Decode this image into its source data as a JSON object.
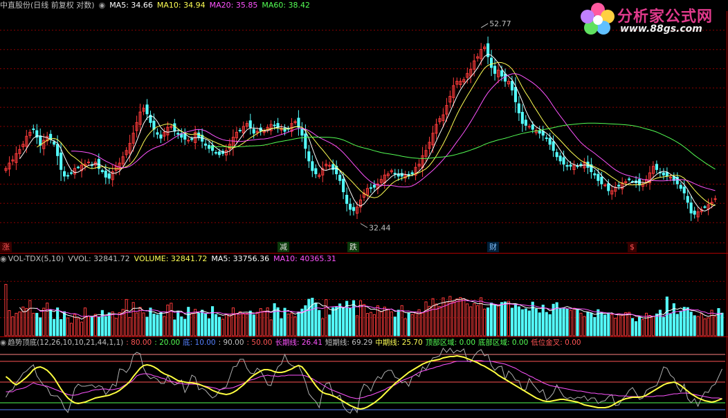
{
  "header": {
    "price": {
      "title": "中直股份(日线 前复权 对数)",
      "ma5": "MA5: 34.66",
      "ma10": "MA10: 34.94",
      "ma20": "MA20: 35.85",
      "ma60": "MA60: 38.42"
    },
    "vol": {
      "title": "VOL-TDX(5,10)",
      "vvol": "VVOL: 32841.72",
      "volume": "VOLUME: 32841.72",
      "ma5": "MA5: 33756.36",
      "ma10": "MA10: 40365.31"
    },
    "ind": {
      "title": "趋势顶底(12,26,10,10,21,44,1,1)",
      "v80": ": 80.00",
      "v20": ": 20.00",
      "di": "底: 10.00",
      "v90": ": 90.00",
      "v50": ": 50.00",
      "chang": "长期线: 26.41",
      "duan": "短期线: 69.29",
      "zhong": "中期线: 25.70",
      "dingqu": "顶部区域: 0.00",
      "diqu": "底部区域: 0.00",
      "jincha": "低位金叉: 0.00"
    }
  },
  "logo": {
    "text": "分析家公式网",
    "url": "www.88gs.com"
  },
  "events": {
    "zhang": "涨",
    "jian": "减",
    "die": "跌",
    "cai": "财",
    "dollar": "$"
  },
  "colors": {
    "up": "#ff3b3b",
    "down": "#54ffff",
    "ma5": "#ffffff",
    "ma10": "#ffff54",
    "ma20": "#ff54ff",
    "ma60": "#54ff54",
    "grid": "#8c0000",
    "text": "#c0c0c0"
  },
  "chart_data": [
    {
      "type": "candlestick",
      "name": "price",
      "title": "中直股份(日线 前复权 对数)",
      "log_scale": true,
      "ylim": [
        31,
        55
      ],
      "annotations": [
        {
          "label": "52.77",
          "day": 138,
          "price": 52.77
        },
        {
          "label": "32.44",
          "day": 103,
          "price": 32.44
        }
      ],
      "close": [
        37.2,
        37.7,
        38.0,
        38.6,
        39.0,
        39.5,
        40.3,
        40.7,
        41.0,
        40.2,
        39.4,
        39.9,
        40.3,
        40.0,
        39.5,
        38.4,
        37.1,
        36.5,
        36.5,
        36.8,
        37.2,
        37.3,
        37.5,
        37.6,
        37.8,
        37.5,
        37.8,
        37.2,
        36.9,
        36.4,
        36.3,
        36.9,
        37.4,
        37.7,
        38.3,
        38.9,
        39.6,
        40.6,
        41.7,
        42.8,
        43.2,
        42.6,
        41.7,
        41.0,
        40.5,
        40.1,
        40.7,
        41.2,
        41.3,
        40.8,
        40.5,
        40.2,
        40.0,
        39.9,
        40.0,
        40.7,
        40.2,
        39.8,
        39.4,
        39.1,
        38.9,
        38.7,
        38.5,
        38.6,
        38.9,
        39.5,
        40.2,
        40.7,
        40.9,
        41.3,
        41.6,
        41.2,
        40.6,
        40.8,
        40.8,
        40.8,
        41.2,
        41.5,
        41.4,
        41.2,
        41.1,
        40.8,
        41.0,
        41.6,
        41.8,
        41.2,
        40.4,
        39.1,
        37.9,
        37.0,
        36.7,
        36.6,
        37.2,
        37.6,
        37.5,
        37.1,
        36.7,
        36.1,
        35.1,
        34.1,
        33.6,
        33.5,
        33.8,
        34.4,
        35.0,
        35.4,
        35.4,
        35.5,
        35.8,
        36.2,
        36.6,
        36.7,
        37.0,
        36.7,
        36.5,
        36.5,
        36.6,
        36.5,
        36.7,
        37.3,
        37.6,
        38.4,
        38.9,
        39.7,
        40.6,
        41.5,
        42.1,
        42.5,
        43.5,
        44.5,
        45.7,
        46.2,
        46.2,
        46.4,
        47.1,
        47.6,
        48.6,
        49.1,
        50.0,
        50.3,
        49.1,
        47.8,
        47.1,
        47.5,
        46.8,
        46.2,
        46.2,
        45.2,
        43.9,
        42.7,
        41.6,
        41.4,
        41.3,
        41.0,
        40.9,
        40.6,
        40.4,
        40.1,
        39.5,
        38.9,
        38.3,
        37.9,
        37.6,
        37.4,
        37.4,
        37.5,
        37.4,
        37.5,
        37.8,
        37.3,
        36.9,
        36.6,
        36.1,
        35.8,
        35.7,
        35.2,
        35.2,
        35.5,
        35.6,
        35.9,
        36.0,
        36.2,
        36.0,
        35.9,
        35.7,
        35.8,
        36.2,
        36.8,
        37.4,
        37.1,
        36.8,
        36.6,
        36.5,
        36.4,
        36.1,
        35.8,
        35.4,
        35.0,
        34.2,
        33.3,
        33.2,
        33.4,
        33.6,
        33.8,
        34.0,
        34.2,
        34.5
      ],
      "ma_current": {
        "MA5": 34.66,
        "MA10": 34.94,
        "MA20": 35.85,
        "MA60": 38.42
      }
    },
    {
      "type": "bar",
      "name": "volume",
      "title": "VOL-TDX(5,10)",
      "ylim": [
        0,
        80000
      ],
      "values": [
        56700,
        27800,
        21000,
        24800,
        26400,
        31800,
        30200,
        38900,
        24800,
        24800,
        19900,
        30500,
        36100,
        28500,
        18100,
        30800,
        17900,
        26600,
        19700,
        13900,
        23500,
        19000,
        15200,
        30700,
        21400,
        21200,
        23600,
        20500,
        28000,
        21200,
        25300,
        26400,
        19300,
        25600,
        29100,
        40100,
        20300,
        36700,
        25200,
        31400,
        25200,
        20600,
        30600,
        24000,
        23100,
        25500,
        21400,
        34000,
        36000,
        17500,
        27300,
        20900,
        18300,
        31500,
        24700,
        29200,
        24800,
        28300,
        24500,
        18800,
        32200,
        23500,
        20400,
        18300,
        23400,
        23600,
        30800,
        24700,
        26500,
        24000,
        24700,
        27300,
        23100,
        25900,
        30000,
        27200,
        30800,
        17600,
        35500,
        30900,
        18900,
        30400,
        24000,
        25000,
        21000,
        26400,
        29500,
        33200,
        40300,
        41500,
        36300,
        28000,
        18900,
        39900,
        23000,
        31000,
        31700,
        35200,
        30900,
        38100,
        30200,
        38800,
        22200,
        38700,
        34600,
        24700,
        25800,
        23400,
        33100,
        26500,
        31700,
        29500,
        26500,
        20700,
        28300,
        33300,
        18800,
        25500,
        23500,
        25000,
        28800,
        25100,
        37400,
        32500,
        41000,
        35100,
        32300,
        41800,
        37300,
        43400,
        37400,
        40600,
        42300,
        40900,
        35200,
        32000,
        35400,
        33400,
        42000,
        29500,
        30800,
        36200,
        33600,
        34300,
        36700,
        37300,
        38000,
        30500,
        34900,
        32000,
        28800,
        29700,
        27400,
        37200,
        29600,
        25300,
        33900,
        25800,
        23400,
        34800,
        36600,
        30500,
        29700,
        29400,
        27900,
        30400,
        29400,
        24900,
        21300,
        26000,
        25100,
        20300,
        28800,
        26000,
        22900,
        25300,
        23500,
        19400,
        24300,
        22300,
        25500,
        25800,
        19100,
        15600,
        20400,
        17800,
        24900,
        22400,
        21300,
        24100,
        28300,
        20400,
        42800,
        24100,
        35400,
        23700,
        27200,
        31500,
        31100,
        26100,
        22200,
        21400,
        24500,
        18700,
        19800,
        28200,
        21500,
        30100,
        25000
      ],
      "ma_current": {
        "VVOL": 32841.72,
        "VOLUME": 32841.72,
        "MA5": 33756.36,
        "MA10": 40365.31
      }
    },
    {
      "type": "line",
      "name": "indicator",
      "title": "趋势顶底(12,26,10,10,21,44,1,1)",
      "ylim": [
        0,
        100
      ],
      "levels": [
        80,
        20,
        10,
        90,
        50
      ],
      "series": [
        {
          "name": "短期线",
          "current": 69.29,
          "values": [
            28,
            37,
            39,
            49,
            55,
            63,
            66,
            71,
            75,
            59,
            52,
            45,
            42,
            31,
            30,
            30,
            24,
            12,
            6,
            22,
            41,
            47,
            44,
            44,
            45,
            46,
            42,
            45,
            43,
            32,
            38,
            47,
            44,
            69,
            68,
            64,
            71,
            89,
            93,
            91,
            70,
            60,
            55,
            57,
            54,
            48,
            48,
            59,
            50,
            46,
            48,
            53,
            35,
            45,
            60,
            57,
            39,
            41,
            38,
            32,
            27,
            30,
            38,
            41,
            43,
            57,
            72,
            73,
            83,
            83,
            70,
            63,
            62,
            70,
            66,
            57,
            46,
            45,
            61,
            72,
            76,
            90,
            78,
            74,
            72,
            74,
            63,
            50,
            33,
            27,
            22,
            13,
            38,
            48,
            49,
            31,
            28,
            31,
            15,
            8,
            5,
            14,
            6,
            35,
            47,
            44,
            37,
            50,
            58,
            55,
            64,
            67,
            67,
            57,
            55,
            49,
            51,
            44,
            58,
            61,
            58,
            72,
            68,
            77,
            85,
            86,
            88,
            99,
            93,
            99,
            92,
            96,
            94,
            98,
            81,
            79,
            88,
            94,
            97,
            88,
            90,
            74,
            67,
            72,
            73,
            54,
            66,
            61,
            53,
            52,
            38,
            39,
            55,
            47,
            41,
            35,
            39,
            24,
            28,
            34,
            46,
            37,
            29,
            26,
            28,
            25,
            28,
            27,
            30,
            23,
            27,
            27,
            19,
            22,
            23,
            29,
            32,
            16,
            17,
            25,
            30,
            38,
            42,
            34,
            25,
            27,
            38,
            41,
            43,
            45,
            57,
            72,
            70,
            60,
            56,
            43,
            36,
            47,
            26,
            20,
            26,
            15,
            27,
            36,
            35,
            44,
            47,
            58,
            69
          ]
        },
        {
          "name": "长期线",
          "current": 26.41,
          "values": [
            36,
            36,
            36,
            39,
            40,
            41,
            43,
            46,
            49,
            47,
            46,
            45,
            44,
            42,
            40,
            38,
            36,
            34,
            32,
            31,
            31,
            32,
            34,
            35,
            36,
            38,
            39,
            39,
            40,
            40,
            39,
            39,
            40,
            41,
            44,
            47,
            49,
            53,
            59,
            61,
            62,
            62,
            61,
            59,
            58,
            56,
            55,
            52,
            51,
            50,
            48,
            48,
            47,
            47,
            47,
            47,
            46,
            45,
            44,
            43,
            42,
            41,
            39,
            40,
            41,
            41,
            42,
            44,
            46,
            48,
            51,
            53,
            54,
            56,
            58,
            59,
            60,
            59,
            59,
            58,
            59,
            59,
            60,
            60,
            60,
            60,
            60,
            59,
            57,
            55,
            52,
            49,
            46,
            43,
            40,
            38,
            36,
            34,
            32,
            30,
            28,
            27,
            26,
            27,
            28,
            30,
            31,
            33,
            35,
            37,
            39,
            42,
            44,
            46,
            49,
            52,
            54,
            56,
            58,
            61,
            64,
            66,
            67,
            69,
            70,
            72,
            73,
            75,
            76,
            77,
            79,
            80,
            80,
            80,
            80,
            80,
            81,
            81,
            81,
            80,
            80,
            80,
            79,
            78,
            77,
            76,
            74,
            72,
            70,
            67,
            64,
            62,
            59,
            57,
            54,
            52,
            49,
            47,
            45,
            44,
            43,
            42,
            41,
            40,
            39,
            38,
            37,
            37,
            36,
            35,
            34,
            34,
            33,
            33,
            32,
            32,
            31,
            31,
            30,
            30,
            30,
            29,
            29,
            29,
            29,
            29,
            29,
            29,
            29,
            30,
            30,
            30,
            31,
            32,
            33,
            33,
            34,
            34,
            34,
            33,
            32,
            31,
            30,
            29,
            28,
            27,
            27,
            27,
            26
          ]
        },
        {
          "name": "中期线",
          "current": 25.7,
          "values": [
            58,
            54,
            49,
            46,
            49,
            53,
            57,
            62,
            68,
            71,
            72,
            70,
            67,
            62,
            56,
            48,
            40,
            33,
            27,
            23,
            20,
            19,
            20,
            21,
            23,
            25,
            27,
            28,
            29,
            30,
            31,
            33,
            35,
            38,
            42,
            46,
            51,
            58,
            64,
            70,
            74,
            75,
            74,
            72,
            69,
            65,
            62,
            60,
            58,
            55,
            52,
            51,
            50,
            49,
            49,
            48,
            47,
            45,
            43,
            41,
            38,
            36,
            34,
            33,
            32,
            33,
            35,
            38,
            42,
            46,
            51,
            56,
            60,
            63,
            66,
            68,
            68,
            67,
            65,
            64,
            64,
            65,
            67,
            69,
            72,
            74,
            72,
            66,
            59,
            52,
            45,
            39,
            35,
            33,
            32,
            30,
            28,
            25,
            22,
            19,
            16,
            14,
            12,
            11,
            12,
            14,
            17,
            20,
            24,
            28,
            33,
            38,
            43,
            48,
            52,
            56,
            60,
            64,
            67,
            70,
            73,
            76,
            78,
            80,
            81,
            82,
            83,
            85,
            86,
            87,
            87,
            88,
            87,
            86,
            84,
            82,
            80,
            78,
            75,
            73,
            70,
            67,
            64,
            60,
            57,
            54,
            51,
            48,
            45,
            42,
            39,
            36,
            33,
            30,
            27,
            25,
            23,
            22,
            22,
            23,
            24,
            25,
            25,
            24,
            23,
            22,
            21,
            19,
            17,
            16,
            15,
            14,
            13,
            13,
            13,
            14,
            16,
            19,
            22,
            24,
            26,
            27,
            28,
            28,
            28,
            29,
            31,
            34,
            37,
            40,
            43,
            46,
            48,
            49,
            50,
            48,
            45,
            41,
            37,
            33,
            30,
            27,
            25,
            23,
            22,
            21,
            22,
            24,
            26
          ]
        }
      ],
      "current": {
        "80": 80.0,
        "20": 20.0,
        "底": 10.0,
        "90": 90.0,
        "50": 50.0,
        "顶部区域": 0.0,
        "底部区域": 0.0,
        "低位金叉": 0.0
      }
    }
  ]
}
